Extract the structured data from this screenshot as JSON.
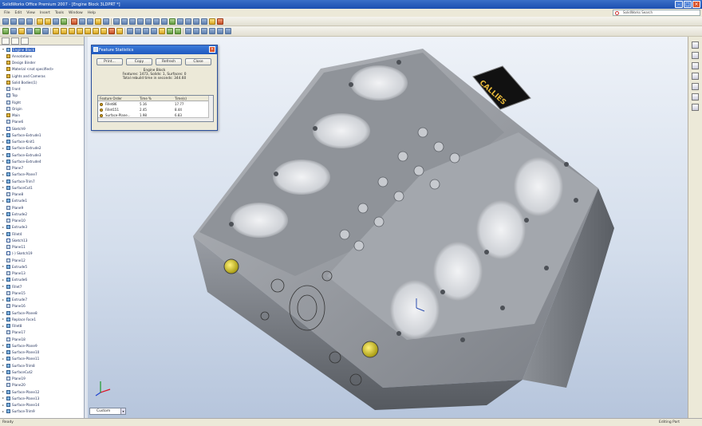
{
  "window": {
    "title": "SolidWorks Office Premium 2007 - [Engine Block 3LDPRT *]"
  },
  "menu": [
    "File",
    "Edit",
    "View",
    "Insert",
    "Tools",
    "Window",
    "Help"
  ],
  "search": {
    "label": "SolidWorks Search"
  },
  "tree": {
    "root": "Engine Block",
    "items": [
      {
        "label": "Annotations",
        "icon": "folder"
      },
      {
        "label": "Design Binder",
        "icon": "folder"
      },
      {
        "label": "Material <not specified>",
        "icon": "folder"
      },
      {
        "label": "Lights and Cameras",
        "icon": "folder"
      },
      {
        "label": "Solid Bodies(1)",
        "icon": "folder"
      },
      {
        "label": "Front",
        "icon": "plane"
      },
      {
        "label": "Top",
        "icon": "plane"
      },
      {
        "label": "Right",
        "icon": "plane"
      },
      {
        "label": "Origin",
        "icon": "plane"
      },
      {
        "label": "Main",
        "icon": "folder"
      },
      {
        "label": "Plane6",
        "icon": "plane"
      },
      {
        "label": "Sketch9",
        "icon": "sketch"
      },
      {
        "label": "Surface-Extrude1",
        "icon": "feature"
      },
      {
        "label": "Surface-Knit1",
        "icon": "feature"
      },
      {
        "label": "Surface-Extrude2",
        "icon": "feature"
      },
      {
        "label": "Surface-Extrude3",
        "icon": "feature"
      },
      {
        "label": "Surface-Extrude4",
        "icon": "feature"
      },
      {
        "label": "Plane7",
        "icon": "plane"
      },
      {
        "label": "Surface-Plane7",
        "icon": "feature"
      },
      {
        "label": "Surface-Trim7",
        "icon": "feature"
      },
      {
        "label": "SurfaceCut1",
        "icon": "feature"
      },
      {
        "label": "Plane8",
        "icon": "plane"
      },
      {
        "label": "Extrude1",
        "icon": "feature"
      },
      {
        "label": "Plane9",
        "icon": "plane"
      },
      {
        "label": "Extrude2",
        "icon": "feature"
      },
      {
        "label": "Plane10",
        "icon": "plane"
      },
      {
        "label": "Extrude3",
        "icon": "feature"
      },
      {
        "label": "Fillet4",
        "icon": "feature"
      },
      {
        "label": "Sketch13",
        "icon": "sketch"
      },
      {
        "label": "Plane11",
        "icon": "plane"
      },
      {
        "label": "(-) Sketch19",
        "icon": "sketch"
      },
      {
        "label": "Plane12",
        "icon": "plane"
      },
      {
        "label": "Extrude5",
        "icon": "feature"
      },
      {
        "label": "Plane13",
        "icon": "plane"
      },
      {
        "label": "Extrude6",
        "icon": "feature"
      },
      {
        "label": "Fillet7",
        "icon": "feature"
      },
      {
        "label": "Plane15",
        "icon": "plane"
      },
      {
        "label": "Extrude7",
        "icon": "feature"
      },
      {
        "label": "Plane16",
        "icon": "plane"
      },
      {
        "label": "Surface-Plane8",
        "icon": "feature"
      },
      {
        "label": "Replace Face1",
        "icon": "feature"
      },
      {
        "label": "Fillet8",
        "icon": "feature"
      },
      {
        "label": "Plane17",
        "icon": "plane"
      },
      {
        "label": "Plane18",
        "icon": "plane"
      },
      {
        "label": "Surface-Plane9",
        "icon": "feature"
      },
      {
        "label": "Surface-Plane10",
        "icon": "feature"
      },
      {
        "label": "Surface-Plane11",
        "icon": "feature"
      },
      {
        "label": "Surface-Trim8",
        "icon": "feature"
      },
      {
        "label": "SurfaceCut2",
        "icon": "feature"
      },
      {
        "label": "Plane19",
        "icon": "plane"
      },
      {
        "label": "Plane20",
        "icon": "plane"
      },
      {
        "label": "Surface-Plane12",
        "icon": "feature"
      },
      {
        "label": "Surface-Plane13",
        "icon": "feature"
      },
      {
        "label": "Surface-Plane14",
        "icon": "feature"
      },
      {
        "label": "Surface-Trim9",
        "icon": "feature"
      }
    ]
  },
  "dialog": {
    "title": "Feature Statistics",
    "buttons": {
      "print": "Print...",
      "copy": "Copy",
      "refresh": "Refresh",
      "close": "Close"
    },
    "part_name": "Engine Block",
    "summary": "Features: 1473, Solids: 1, Surfaces: 0",
    "rebuild": "Total rebuild time in seconds: 344.60",
    "columns": [
      "Feature Order",
      "Time %",
      "Time(s)"
    ],
    "rows": [
      [
        "Fillet86",
        "5.16",
        "17.77"
      ],
      [
        "Fillet151",
        "2.45",
        "8.44"
      ],
      [
        "Surface-Plane...",
        "1.98",
        "6.83"
      ]
    ]
  },
  "logo_text": "CALLIES",
  "configuration": {
    "selected": "Custom"
  },
  "status": {
    "left": "Ready",
    "right": "Editing Part"
  },
  "colors": {
    "accent": "#1f58bf",
    "viewport_top": "#eef2f8",
    "viewport_bottom": "#b6c5dc"
  }
}
